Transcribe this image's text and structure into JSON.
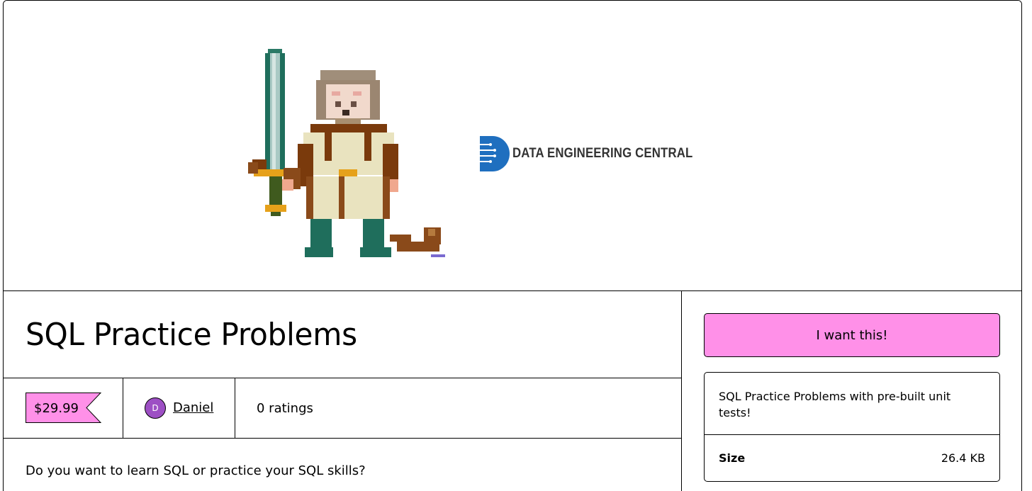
{
  "cover": {
    "brand_name": "DATA ENGINEERING CENTRAL",
    "art_icon": "pixel-art-warrior-with-sword"
  },
  "product": {
    "title": "SQL Practice Problems",
    "price": "$29.99",
    "author_initial": "D",
    "author_name": "Daniel",
    "ratings": "0 ratings",
    "description": "Do you want to learn SQL or practice your SQL skills?"
  },
  "sidebar": {
    "buy_label": "I want this!",
    "summary": "SQL Practice Problems with pre-built unit tests!",
    "size_label": "Size",
    "size_value": "26.4 KB"
  },
  "colors": {
    "accent_pink": "#ff90e8",
    "avatar_purple": "#9d4fc4",
    "brand_blue": "#1f6fbf"
  }
}
